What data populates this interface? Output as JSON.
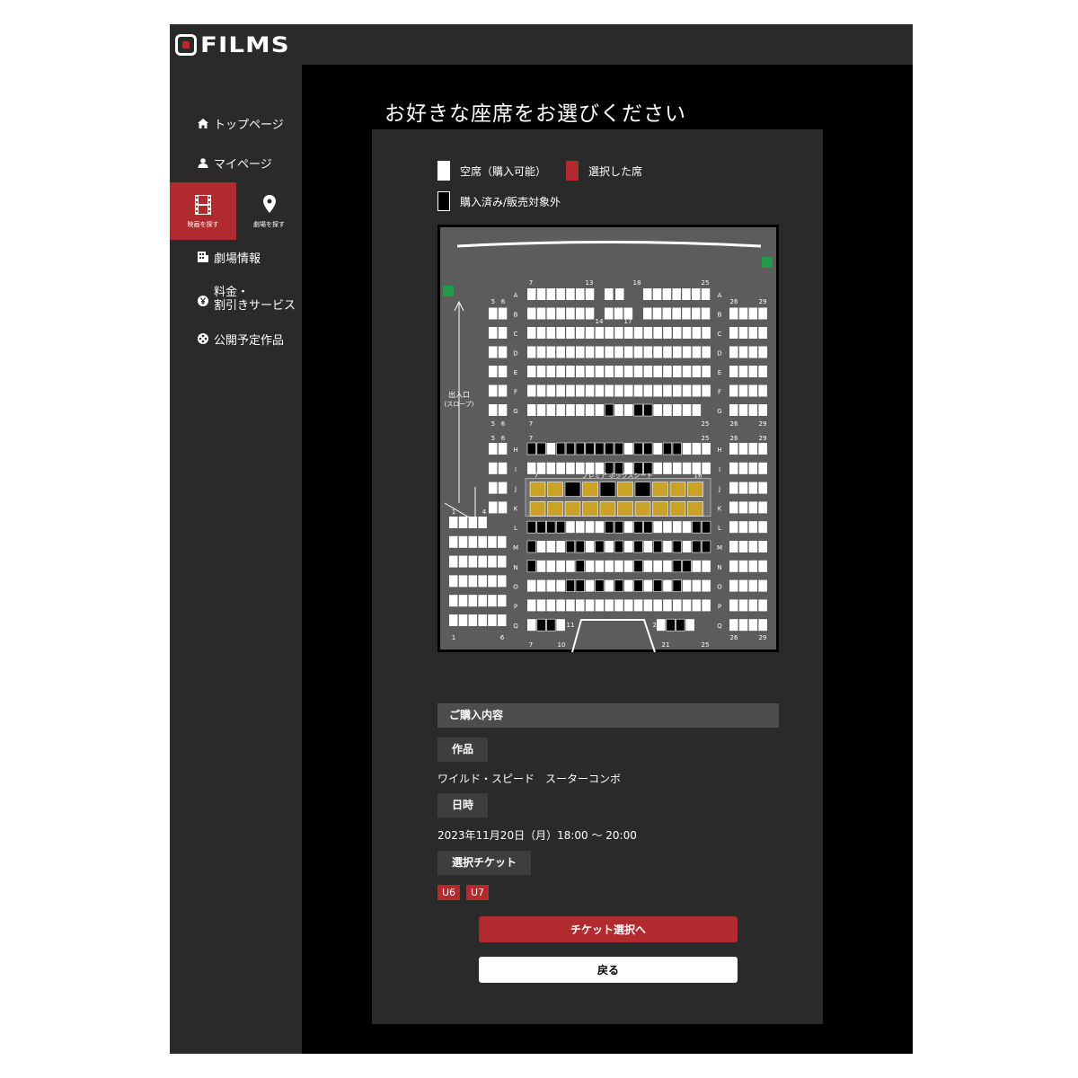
{
  "app": {
    "logo_text": "FILMS"
  },
  "sidebar": {
    "top": "トップページ",
    "mypage": "マイページ",
    "find_movie": "映画を探す",
    "find_theater": "劇場を探す",
    "theater_info": "劇場情報",
    "price": "料金・\n割引きサービス",
    "upcoming": "公開予定作品"
  },
  "main": {
    "title": "お好きな座席をお選びください"
  },
  "legend": {
    "available": "空席（購入可能）",
    "selected": "選択した席",
    "sold": "購入済み/販売対象外"
  },
  "colors": {
    "accent": "#b12a2d",
    "panel": "#2a2a2a",
    "map_floor": "#5c5c5c",
    "premium": "#c9a227"
  },
  "seatmap": {
    "exit_label": "出入口\n(スロープ)",
    "premium_label": "プレミア ボックスシート",
    "rows_upper": [
      "A",
      "B",
      "C",
      "D",
      "E",
      "F",
      "G"
    ],
    "rows_lower": [
      "H",
      "I",
      "J",
      "K",
      "L",
      "M",
      "N",
      "O",
      "P",
      "Q"
    ],
    "col_labels_top": [
      "7",
      "13",
      "18",
      "25",
      "26",
      "29",
      "5",
      "6"
    ],
    "col_labels_mid": [
      "14",
      "17"
    ],
    "col_labels_row_g": [
      "5",
      "6",
      "7",
      "25",
      "26",
      "29"
    ],
    "col_labels_row_h": [
      "5",
      "6",
      "7",
      "25",
      "26",
      "29"
    ],
    "col_labels_j": [
      "7",
      "16"
    ],
    "col_labels_left": [
      "1",
      "4"
    ],
    "col_labels_bottom": [
      "1",
      "6",
      "7",
      "10",
      "11",
      "20",
      "21",
      "25",
      "26",
      "29"
    ]
  },
  "purchase": {
    "heading": "ご購入内容",
    "work_label": "作品",
    "work_value": "ワイルド・スピード　スーターコンボ",
    "date_label": "日時",
    "date_value": "2023年11月20日（月）18:00 〜 20:00",
    "ticket_label": "選択チケット",
    "seats": [
      "U6",
      "U7"
    ]
  },
  "buttons": {
    "next": "チケット選択へ",
    "back": "戻る"
  }
}
